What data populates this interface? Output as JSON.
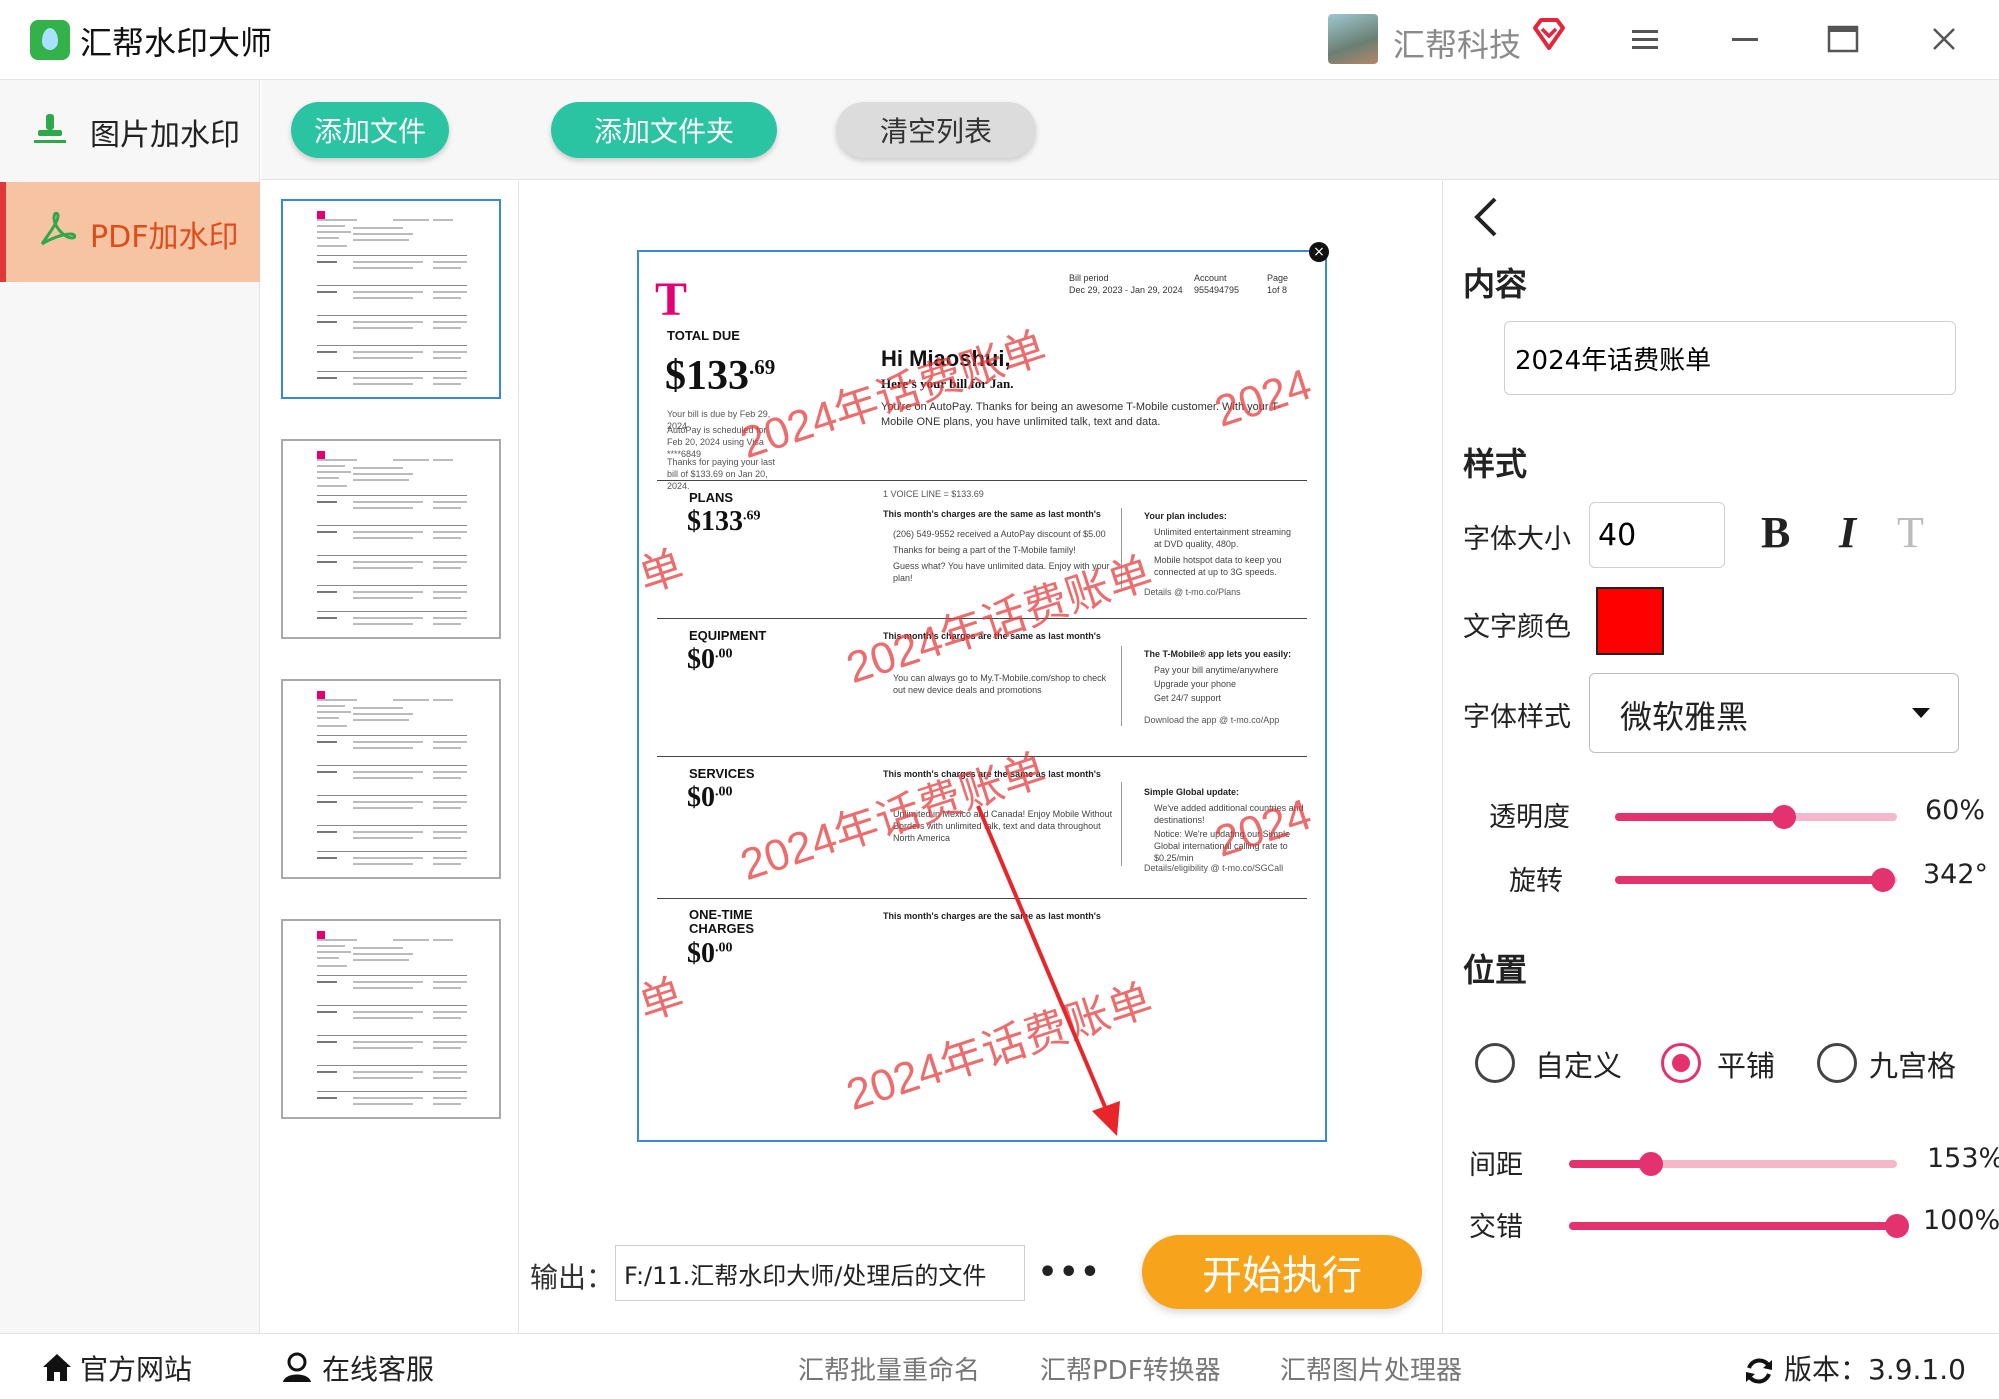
{
  "app": {
    "title": "汇帮水印大师",
    "brand": "汇帮科技"
  },
  "nav": {
    "image_watermark": "图片加水印",
    "pdf_watermark": "PDF加水印"
  },
  "toolbar": {
    "add_file": "添加文件",
    "add_folder": "添加文件夹",
    "clear_list": "清空列表"
  },
  "doc": {
    "meta": {
      "bill_period_label": "Bill period",
      "bill_period": "Dec 29, 2023 - Jan 29, 2024",
      "account_label": "Account",
      "account": "955494795",
      "page_label": "Page",
      "page": "1of 8"
    },
    "total_due_label": "TOTAL DUE",
    "total_due_main": "$133",
    "total_due_cents": ".69",
    "due_note": "Your bill is due by Feb 29, 2024",
    "autopay_note": "AutoPay is scheduled for Feb 20, 2024 using Visa ****6849",
    "thanks_note": "Thanks for paying your last bill of $133.69 on Jan 20, 2024.",
    "greeting": "Hi Miaoshui,",
    "subgreeting": "Here's your bill for Jan.",
    "intro": "You're on AutoPay. Thanks for being an awesome T-Mobile customer. With your T-Mobile ONE plans, you have unlimited talk, text and data.",
    "plans_label": "PLANS",
    "plans_main": "$133",
    "plans_cents": ".69",
    "voice_line": "1 VOICE LINE = $133.69",
    "same_charges": "This month's charges are the same as last month's",
    "plans_bullets": [
      "(206) 549-9552 received a AutoPay discount of $5.00",
      "Thanks for being a part of the T-Mobile family!",
      "Guess what? You have unlimited data. Enjoy with your plan!"
    ],
    "plan_includes_title": "Your plan includes:",
    "plan_includes": [
      "Unlimited entertainment streaming at DVD quality, 480p.",
      "Mobile hotspot data to keep you connected at up to 3G speeds."
    ],
    "plans_details": "Details @ t-mo.co/Plans",
    "equipment_label": "EQUIPMENT",
    "equipment_main": "$0",
    "equipment_cents": ".00",
    "equipment_bullet": "You can always go to My.T-Mobile.com/shop to check out new device deals and promotions",
    "app_title": "The T-Mobile® app lets you easily:",
    "app_items": [
      "Pay your bill anytime/anywhere",
      "Upgrade your phone",
      "Get 24/7 support"
    ],
    "app_download": "Download the app @ t-mo.co/App",
    "services_label": "SERVICES",
    "services_main": "$0",
    "services_cents": ".00",
    "services_bullet": "Unlimited in Mexico and Canada! Enjoy Mobile Without Borders with unlimited talk, text and data throughout North America",
    "global_title": "Simple Global update:",
    "global_items": [
      "We've added additional countries and destinations!",
      "Notice: We're updating our Simple Global international calling rate to $0.25/min"
    ],
    "global_details": "Details/eligibility @ t-mo.co/SGCall",
    "onetime_label": "ONE-TIME CHARGES",
    "onetime_main": "$0",
    "onetime_cents": ".00",
    "watermark_text": "2024年话费账单",
    "watermark_partial_1": "2024",
    "watermark_partial_2": "单",
    "close_glyph": "×"
  },
  "output": {
    "label": "输出：",
    "path": "F:/11.汇帮水印大师/处理后的文件",
    "browse": "•••"
  },
  "start_button": "开始执行",
  "settings": {
    "content_title": "内容",
    "content_value": "2024年话费账单",
    "style_title": "样式",
    "font_size_label": "字体大小",
    "font_size_value": "40",
    "bold": "B",
    "italic": "I",
    "strike": "T",
    "text_color_label": "文字颜色",
    "text_color": "#ff0000",
    "font_style_label": "字体样式",
    "font_style_value": "微软雅黑",
    "opacity_label": "透明度",
    "opacity_value": "60%",
    "opacity": 0.6,
    "rotation_label": "旋转",
    "rotation_value": "342°",
    "rotation": 0.95,
    "position_title": "位置",
    "position_options": [
      "自定义",
      "平铺",
      "九宫格"
    ],
    "position_selected": "平铺",
    "spacing_label": "间距",
    "spacing_value": "153%",
    "spacing": 0.25,
    "stagger_label": "交错",
    "stagger_value": "100%",
    "stagger": 1.0
  },
  "status": {
    "website": "官方网站",
    "support": "在线客服",
    "rename": "汇帮批量重命名",
    "pdf_converter": "汇帮PDF转换器",
    "image_processor": "汇帮图片处理器",
    "version": "版本：3.9.1.0"
  },
  "colors": {
    "accent_teal": "#2ac4a2",
    "accent_orange": "#f7a31c",
    "accent_pink": "#e3326d",
    "watermark_red": "#e63c3c"
  }
}
